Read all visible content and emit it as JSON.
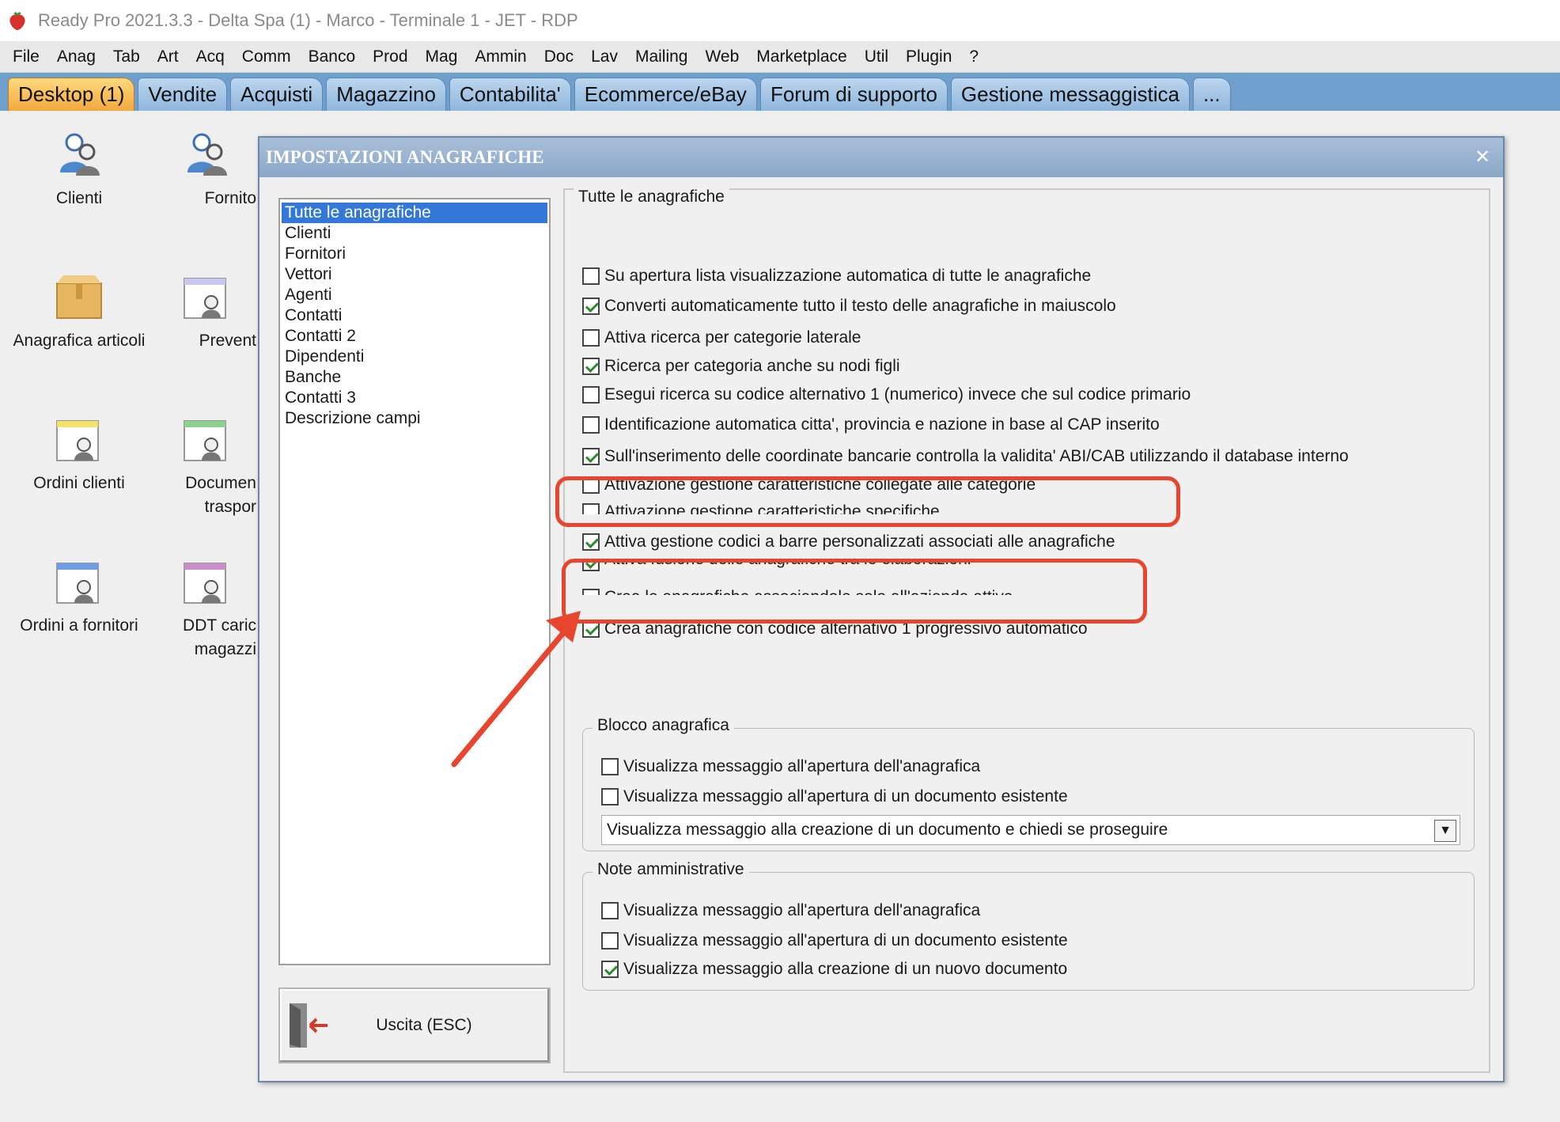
{
  "window": {
    "title": "Ready Pro 2021.3.3 - Delta Spa (1) - Marco - Terminale 1 - JET - RDP"
  },
  "menu": [
    "File",
    "Anag",
    "Tab",
    "Art",
    "Acq",
    "Comm",
    "Banco",
    "Prod",
    "Mag",
    "Ammin",
    "Doc",
    "Lav",
    "Mailing",
    "Web",
    "Marketplace",
    "Util",
    "Plugin",
    "?"
  ],
  "tabs": [
    "Desktop (1)",
    "Vendite",
    "Acquisti",
    "Magazzino",
    "Contabilita'",
    "Ecommerce/eBay",
    "Forum di supporto",
    "Gestione messaggistica",
    "..."
  ],
  "desktop": {
    "icons": [
      {
        "label": "Clienti"
      },
      {
        "label": "Fornito"
      },
      {
        "label": "Anagrafica articoli"
      },
      {
        "label": "Prevent"
      },
      {
        "label": "Ordini clienti"
      },
      {
        "label": "Documen",
        "label2": "traspor"
      },
      {
        "label": "Ordini a fornitori"
      },
      {
        "label": "DDT caric",
        "label2": "magazzi"
      }
    ]
  },
  "dialog": {
    "title": "IMPOSTAZIONI ANAGRAFICHE",
    "close_glyph": "✕",
    "list": [
      "Tutte le anagrafiche",
      "Clienti",
      "Fornitori",
      "Vettori",
      "Agenti",
      "Contatti",
      "Contatti 2",
      "Dipendenti",
      "Banche",
      "Contatti 3",
      "Descrizione campi"
    ],
    "exit_label": "Uscita (ESC)",
    "group_main": {
      "legend": "Tutte le anagrafiche",
      "options": [
        {
          "label": "Su apertura lista visualizzazione automatica di tutte le anagrafiche",
          "checked": false
        },
        {
          "label": "Converti automaticamente tutto il testo delle anagrafiche in maiuscolo",
          "checked": true
        },
        {
          "label": "Attiva ricerca per categorie laterale",
          "checked": false
        },
        {
          "label": "Ricerca per categoria anche su nodi figli",
          "checked": true
        },
        {
          "label": "Esegui ricerca su codice alternativo 1 (numerico) invece che sul codice primario",
          "checked": false
        },
        {
          "label": "Identificazione automatica citta', provincia e nazione in base al CAP inserito",
          "checked": false
        },
        {
          "label": "Sull'inserimento delle coordinate bancarie controlla la validita' ABI/CAB utilizzando il database interno",
          "checked": true
        },
        {
          "label": "Attivazione gestione caratteristiche collegate alle categorie",
          "checked": false
        },
        {
          "label": "Attivazione gestione caratteristiche specifiche",
          "checked": false
        },
        {
          "label": "Attiva gestione codici a barre personalizzati associati alle anagrafiche",
          "checked": true
        },
        {
          "label": "Attiva fusione delle anagrafiche tra le elaborazioni",
          "checked": true
        },
        {
          "label": "Crea le anagrafiche associandole solo all'azienda attiva",
          "checked": false
        },
        {
          "label": "Crea anagrafiche con codice alternativo 1 progressivo automatico",
          "checked": true
        }
      ]
    },
    "group_blocco": {
      "legend": "Blocco anagrafica",
      "options": [
        {
          "label": "Visualizza messaggio all'apertura dell'anagrafica",
          "checked": false
        },
        {
          "label": "Visualizza messaggio all'apertura di un documento esistente",
          "checked": false
        }
      ],
      "select_value": "Visualizza messaggio alla creazione di un documento e chiedi se proseguire"
    },
    "group_note": {
      "legend": "Note amministrative",
      "options": [
        {
          "label": "Visualizza messaggio all'apertura dell'anagrafica",
          "checked": false
        },
        {
          "label": "Visualizza messaggio all'apertura di un documento esistente",
          "checked": false
        },
        {
          "label": "Visualizza messaggio alla creazione di un nuovo documento",
          "checked": true
        }
      ]
    }
  },
  "annotation_color": "#e8452e"
}
